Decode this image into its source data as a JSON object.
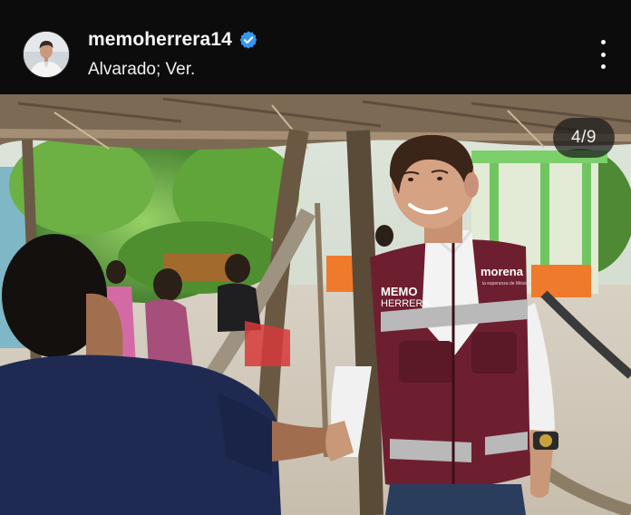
{
  "post": {
    "username": "memoherrera14",
    "location": "Alvarado; Ver.",
    "verified": true,
    "counter": "4/9"
  },
  "photo": {
    "vest_name_line1": "MEMO",
    "vest_name_line2": "HERRERA",
    "vest_brand": "morena",
    "vest_slogan": "la esperanza de México"
  },
  "icons": {
    "verified": "verified-badge-icon",
    "menu": "more-options-icon"
  },
  "colors": {
    "header_bg": "#0c0c0d",
    "verified_blue": "#3797f0",
    "vest_maroon": "#6e1f2f"
  }
}
